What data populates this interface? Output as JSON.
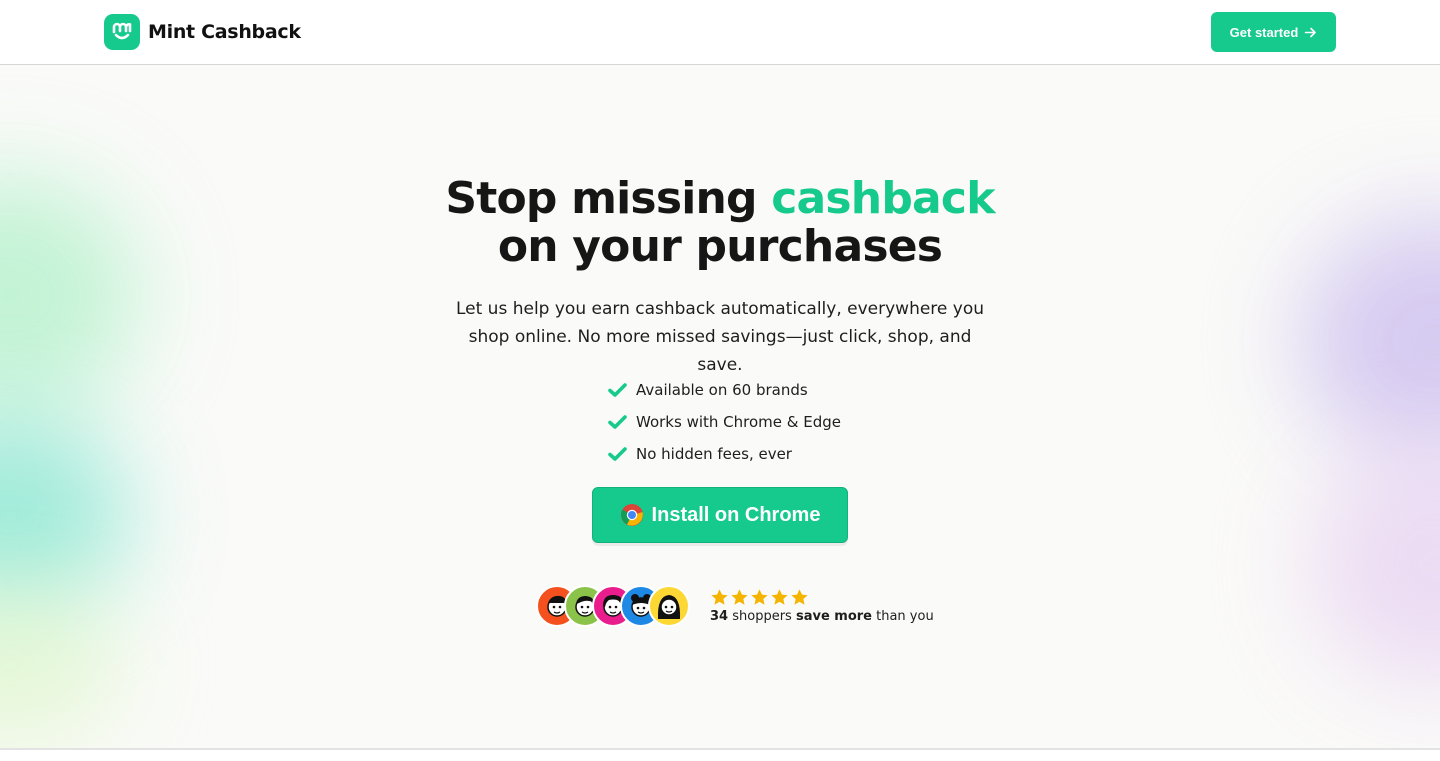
{
  "header": {
    "brand_name": "Mint Cashback",
    "logo_icon": "smile-m-logo-icon",
    "cta_label": "Get started",
    "cta_icon": "arrow-right-icon"
  },
  "hero": {
    "title_part1": "Stop missing ",
    "title_accent": "cashback",
    "title_part2": "on your purchases",
    "subtitle": "Let us help you earn cashback automatically, everywhere you shop online. No more missed savings—just click, shop, and save.",
    "features": [
      "Available on 60 brands",
      "Works with Chrome & Edge",
      "No hidden fees, ever"
    ],
    "install_label": "Install on Chrome",
    "install_icon": "chrome-icon",
    "rating_stars": 5,
    "shopper_count": "34",
    "proof_mid": " shoppers ",
    "proof_bold": "save more",
    "proof_end": " than you"
  },
  "colors": {
    "accent": "#16c98d",
    "star": "#f5b400",
    "avatar_colors": [
      "#f4511e",
      "#8bc34a",
      "#e91e8c",
      "#1e88e5",
      "#fdd835"
    ]
  }
}
